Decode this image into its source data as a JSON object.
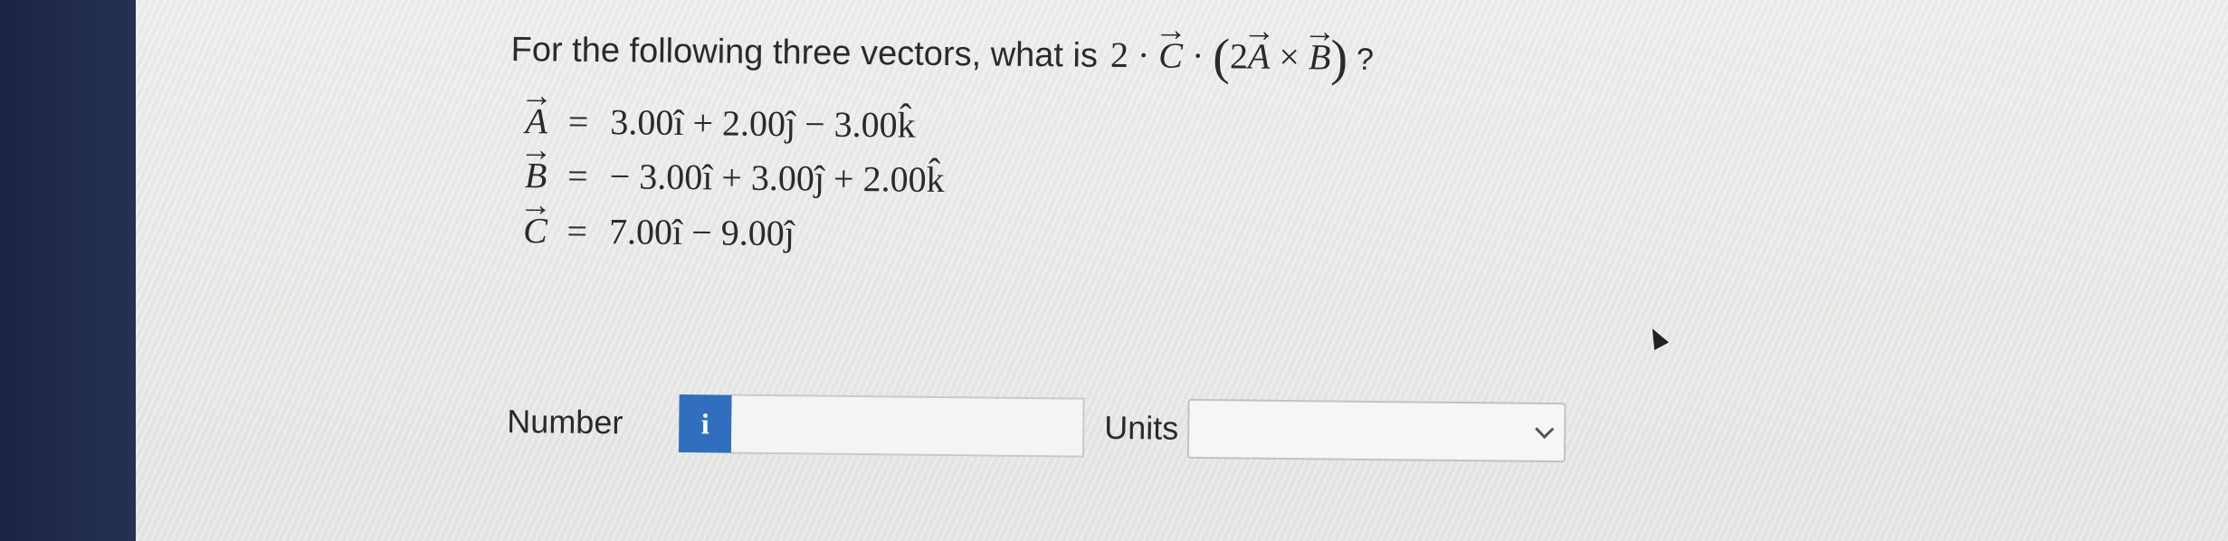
{
  "question": {
    "prefix": "For the following three vectors, what is",
    "expression": {
      "scalar": "2",
      "dot1": "·",
      "vec_c": "C",
      "dot2": "·",
      "open_paren": "(",
      "scalar_a": "2",
      "vec_a": "A",
      "cross": "×",
      "vec_b": "B",
      "close_paren": ")",
      "question_mark": "?"
    }
  },
  "vectors": [
    {
      "name": "A",
      "equals": "=",
      "components": "3.00î + 2.00ĵ − 3.00k̂"
    },
    {
      "name": "B",
      "equals": "=",
      "components": "− 3.00î + 3.00ĵ + 2.00k̂"
    },
    {
      "name": "C",
      "equals": "=",
      "components": "7.00î − 9.00ĵ"
    }
  ],
  "answer": {
    "number_label": "Number",
    "info_icon": "i",
    "number_value": "",
    "units_label": "Units",
    "units_selected": ""
  },
  "icons": {
    "info": "info-icon",
    "dropdown": "chevron-down-icon",
    "cursor": "mouse-cursor-icon"
  },
  "colors": {
    "info_icon_bg": "#2f6fbe"
  }
}
